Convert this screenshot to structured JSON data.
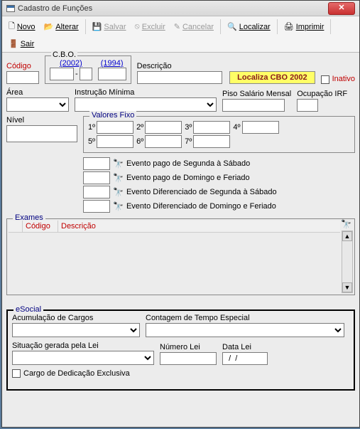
{
  "window": {
    "title": "Cadastro de Funções"
  },
  "toolbar": {
    "novo": "Novo",
    "alterar": "Alterar",
    "salvar": "Salvar",
    "excluir": "Excluir",
    "cancelar": "Cancelar",
    "localizar": "Localizar",
    "imprimir": "Imprimir",
    "sair": "Sair"
  },
  "fields": {
    "codigo": "Código",
    "cbo_title": "C.B.O.",
    "cbo_2002": "(2002)",
    "cbo_1994": "(1994)",
    "cbo_sep": "-",
    "descricao": "Descrição",
    "localiza_cbo": "Localiza CBO 2002",
    "inativo": "Inativo",
    "area": "Área",
    "instrucao": "Instrução Mínima",
    "piso": "Piso Salário Mensal",
    "ocupacao_irf": "Ocupação IRF",
    "nivel": "Nível"
  },
  "valores": {
    "title": "Valores Fixo",
    "l1": "1º",
    "l2": "2º",
    "l3": "3º",
    "l4": "4º",
    "l5": "5º",
    "l6": "6º",
    "l7": "7º"
  },
  "eventos": {
    "e1": "Evento pago de Segunda à Sábado",
    "e2": "Evento pago de Domingo e Feriado",
    "e3": "Evento Diferenciado de Segunda à Sábado",
    "e4": "Evento Diferenciado de Domingo e Feriado"
  },
  "exames": {
    "title": "Exames",
    "col_codigo": "Código",
    "col_desc": "Descrição"
  },
  "esocial": {
    "title": "eSocial",
    "acumulacao": "Acumulação de Cargos",
    "contagem": "Contagem de Tempo Especial",
    "situacao": "Situação gerada pela Lei",
    "numero_lei": "Número Lei",
    "data_lei": "Data Lei",
    "data_lei_val": "  /  /",
    "cargo_dedicacao": "Cargo de Dedicação Exclusiva"
  }
}
